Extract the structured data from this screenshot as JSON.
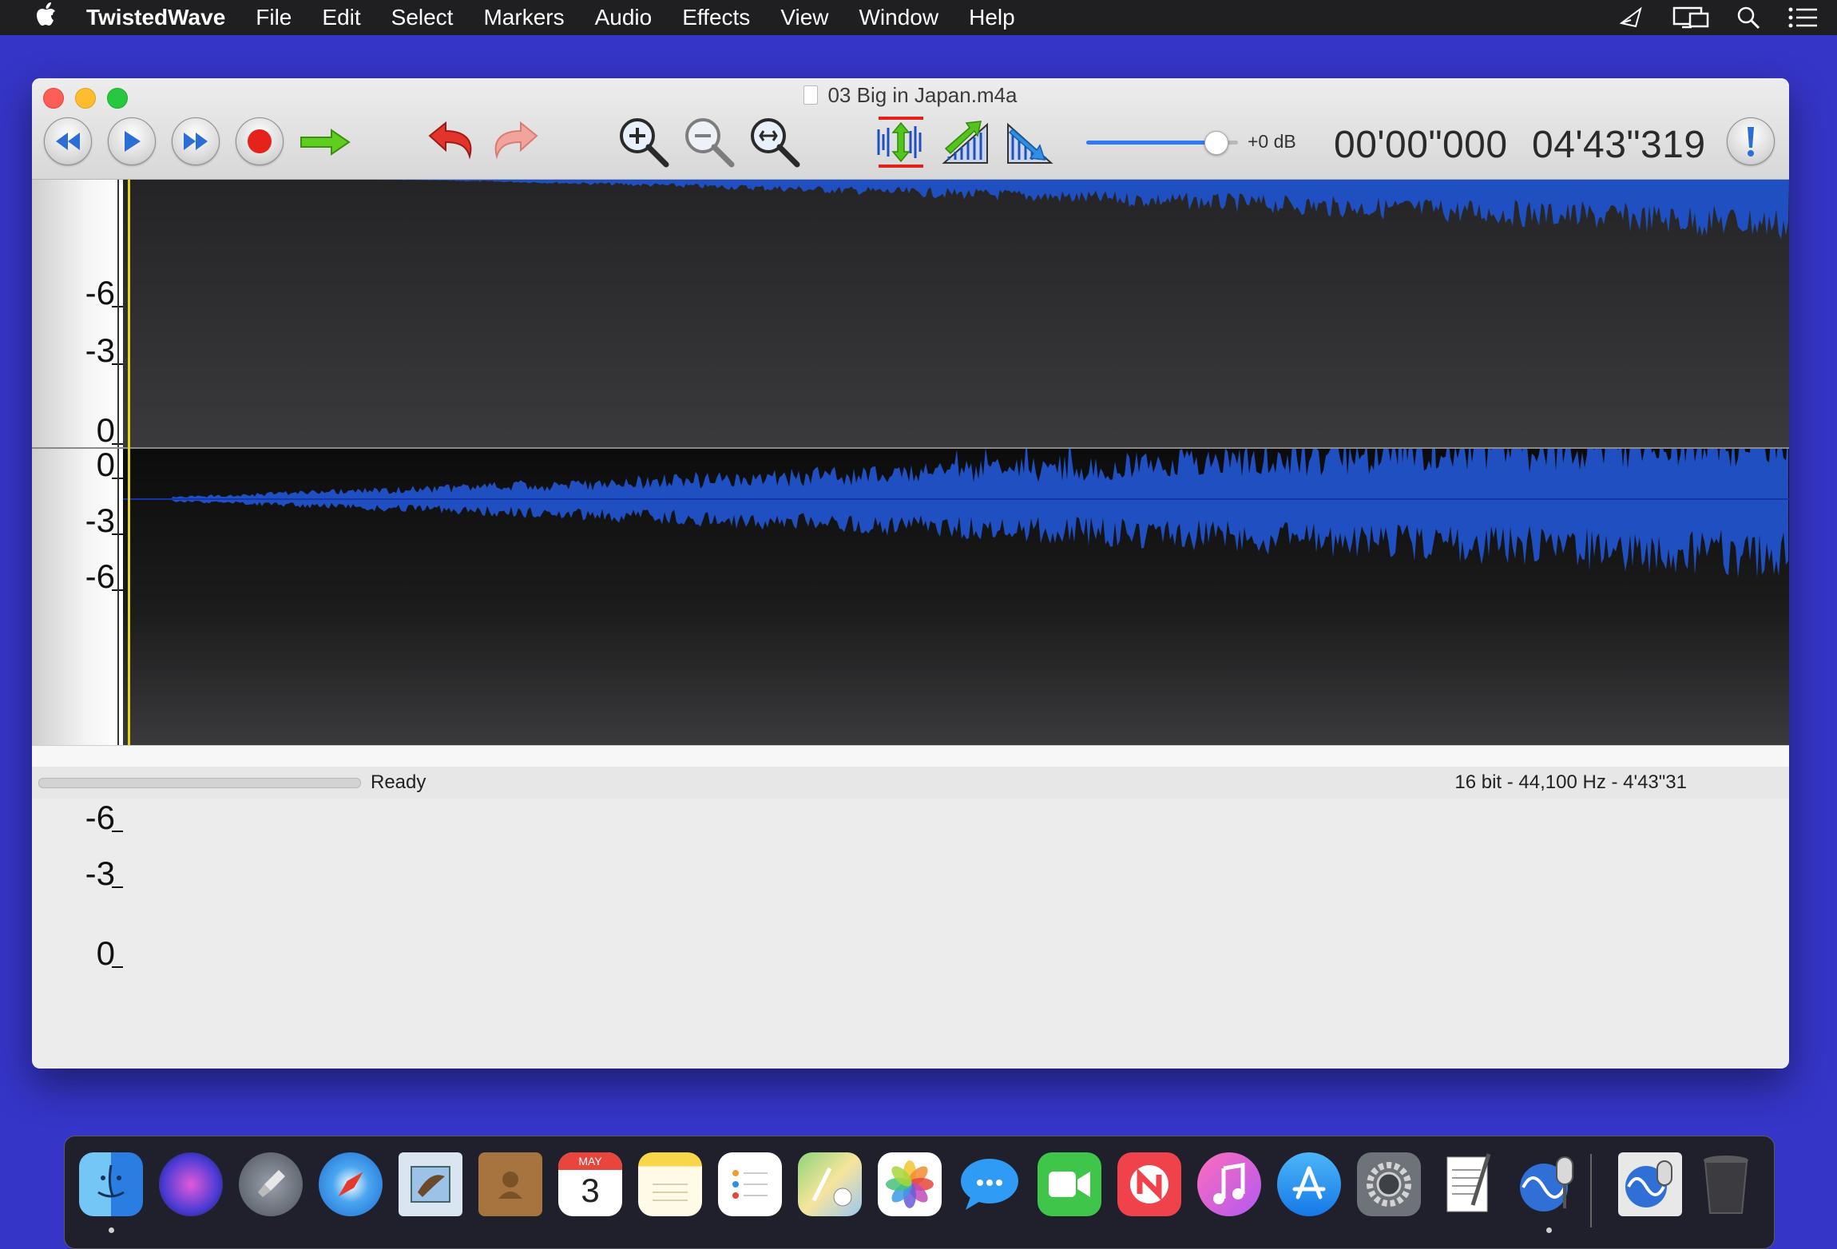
{
  "menubar": {
    "apple": "",
    "app_name": "TwistedWave",
    "items": [
      "File",
      "Edit",
      "Select",
      "Markers",
      "Audio",
      "Effects",
      "View",
      "Window",
      "Help"
    ],
    "status_icons": [
      "airplay-icon",
      "display-mirror-icon",
      "spotlight-search-icon",
      "notification-center-icon"
    ]
  },
  "window": {
    "title": "03 Big in Japan.m4a",
    "toolbar": {
      "transport": [
        "rewind-icon",
        "play-icon",
        "fast-forward-icon",
        "record-icon",
        "go-to-icon"
      ],
      "edit": [
        "undo-icon",
        "redo-icon"
      ],
      "zoom": [
        "zoom-in-icon",
        "zoom-out-icon",
        "zoom-fit-icon"
      ],
      "tools": [
        "normalize-icon",
        "fade-in-icon",
        "fade-out-icon"
      ],
      "volume_level": 0.85,
      "gain_label": "+0 dB",
      "time_current": "00'00\"000",
      "time_total": "04'43\"319",
      "alert_icon": "alert-icon"
    },
    "ruler": {
      "top_channel_ticks": [
        "-6",
        "-3",
        "0"
      ],
      "bottom_channel_ticks": [
        "0",
        "-3",
        "-6",
        "-6",
        "-3",
        "0"
      ]
    },
    "status": {
      "text": "Ready",
      "format": "16 bit - 44,100 Hz - 4'43\"31"
    }
  },
  "colors": {
    "desktop": "#3535c8",
    "waveform": "#1f4fc0",
    "track_top": "#2c2c2e",
    "track_bottom": "#0f0f10",
    "playhead": "#e6d21b"
  },
  "dock": {
    "apps": [
      "Finder",
      "Siri",
      "Launchpad",
      "Safari",
      "Mail",
      "Contacts",
      "Calendar",
      "Notes",
      "Reminders",
      "Maps",
      "Photos",
      "Messages",
      "FaceTime",
      "News",
      "iTunes",
      "App Store",
      "System Preferences",
      "TextEdit",
      "TwistedWave",
      "TwistedWave Document",
      "Trash"
    ],
    "calendar_month": "MAY",
    "calendar_day": "3"
  }
}
